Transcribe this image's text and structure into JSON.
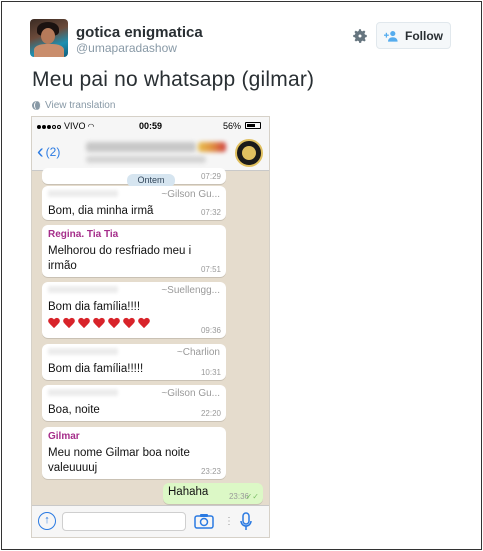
{
  "tweet": {
    "display_name": "gotica enigmatica",
    "handle": "@umaparadashow",
    "follow_label": "Follow",
    "text": "Meu pai no whatsapp (gilmar)",
    "translate_label": "View translation"
  },
  "phone": {
    "status": {
      "carrier": "VIVO",
      "time": "00:59",
      "battery": "56%"
    },
    "nav": {
      "back_count": "(2)"
    },
    "date_label": "Ontem",
    "messages": [
      {
        "sender": "",
        "sender_right": "",
        "text": "",
        "time": "07:29"
      },
      {
        "sender": "",
        "sender_right": "~Gilson Gu...",
        "text": "Bom, dia minha irmã",
        "time": "07:32"
      },
      {
        "sender": "Regina. Tia Tia",
        "sender_right": "",
        "text": "Melhorou do resfriado meu i irmão",
        "text_line1": "Melhorou do resfriado meu i",
        "text_line2": "irmão",
        "time": "07:51"
      },
      {
        "sender": "",
        "sender_right": "~Suellengg...",
        "text": "Bom dia família!!!!",
        "time": "09:36"
      },
      {
        "sender": "",
        "sender_right": "~Charlion",
        "text": "Bom dia família!!!!!",
        "time": "10:31"
      },
      {
        "sender": "",
        "sender_right": "~Gilson Gu...",
        "text": "Boa, noite",
        "time": "22:20"
      },
      {
        "sender": "Gilmar",
        "sender_right": "",
        "text_line1": "Meu nome Gilmar boa noite",
        "text_line2": "valeuuuuj",
        "time": "23:23"
      }
    ],
    "outgoing": {
      "text": "Hahaha",
      "time": "23:36"
    }
  },
  "colors": {
    "accent_blue": "#2a7ae2",
    "sender_magenta": "#a52d8a",
    "chat_bg": "#e5dccd",
    "outgoing_bubble": "#dcf8c6"
  }
}
